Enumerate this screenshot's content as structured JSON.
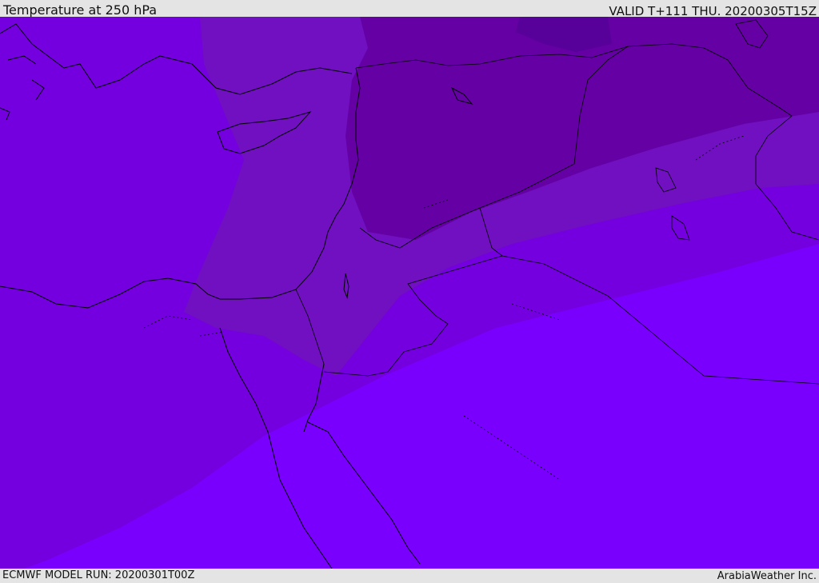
{
  "header": {
    "title": "Temperature at 250 hPa",
    "valid": "VALID T+111 THU. 20200305T15Z"
  },
  "footer": {
    "model_run": "ECMWF MODEL RUN: 20200301T00Z",
    "provider": "ArabiaWeather Inc."
  },
  "map": {
    "colors": {
      "band_warmest": "#7a00fe",
      "band_warm": "#7400df",
      "band_mid": "#7010c0",
      "band_cool": "#6400a4",
      "band_coldest": "#58009a",
      "border": "#000000"
    }
  }
}
